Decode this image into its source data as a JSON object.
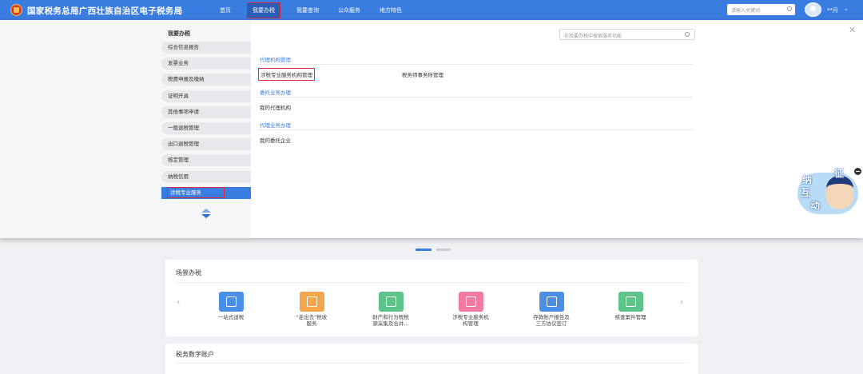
{
  "header": {
    "site_title": "国家税务总局广西壮族自治区电子税务局",
    "nav": [
      "首页",
      "我要办税",
      "我要查询",
      "公众服务",
      "地方特色"
    ],
    "search_placeholder": "请输入关键词",
    "username": "**月"
  },
  "dropdown": {
    "menu_title": "我要办税",
    "menu_items": [
      "综合信息报告",
      "发票业务",
      "税费申报及缴纳",
      "证明开具",
      "其他事项申请",
      "一般退税管理",
      "出口退税管理",
      "核定管理",
      "纳税信用",
      "涉税专业服务"
    ],
    "active_menu": "涉税专业服务",
    "search_placeholder": "在我要办税中搜索服务功能",
    "sections": [
      {
        "title": "代理机构管理",
        "links": [
          "涉税专业服务机构管理",
          "税务师事务所管理"
        ]
      },
      {
        "title": "委托业务办理",
        "links": [
          "我的代理机构"
        ]
      },
      {
        "title": "代理业务办理",
        "links": [
          "我的委托企业"
        ]
      }
    ]
  },
  "mascot": {
    "chars": [
      "征",
      "纳",
      "互",
      "动"
    ]
  },
  "scene_card": {
    "title": "场景办税",
    "items": [
      {
        "label": "一站式退税",
        "color": "#4a8ee6"
      },
      {
        "label": "\"走出去\"税收\n服务",
        "color": "#f3a64b"
      },
      {
        "label": "财产和行为税税\n源采集及合并...",
        "color": "#5fc28a"
      },
      {
        "label": "涉税专业服务机\n构管理",
        "color": "#f07aa0"
      },
      {
        "label": "存款账户报告及\n三方协议签订",
        "color": "#4a8ee6"
      },
      {
        "label": "核查案件管理",
        "color": "#5fc28a"
      }
    ]
  },
  "account_card": {
    "title": "税务数字账户"
  }
}
